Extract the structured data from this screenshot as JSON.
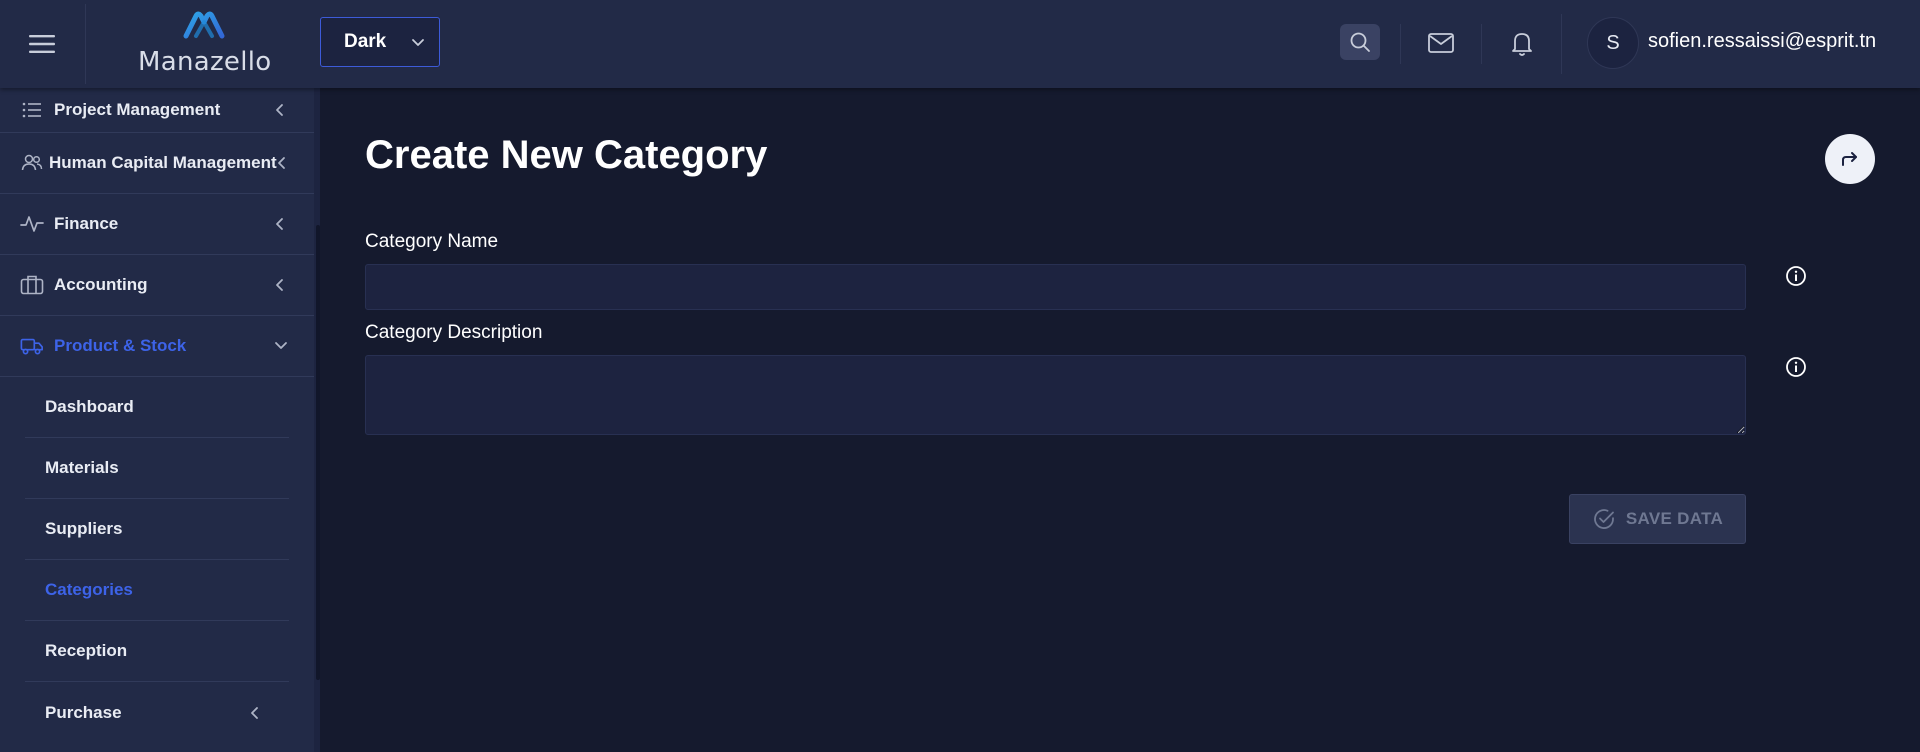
{
  "header": {
    "logo_text": "Manazello",
    "theme_select": {
      "value": "Dark"
    },
    "user_initial": "S",
    "user_email": "sofien.ressaissi@esprit.tn"
  },
  "sidebar": {
    "items": [
      {
        "label": "Project Management",
        "icon": "list-icon"
      },
      {
        "label": "Human Capital Management",
        "icon": "users-icon"
      },
      {
        "label": "Finance",
        "icon": "activity-icon"
      },
      {
        "label": "Accounting",
        "icon": "briefcase-icon"
      },
      {
        "label": "Product & Stock",
        "icon": "truck-icon",
        "expanded": true
      }
    ],
    "subitems": [
      {
        "label": "Dashboard"
      },
      {
        "label": "Materials"
      },
      {
        "label": "Suppliers"
      },
      {
        "label": "Categories",
        "active": true
      },
      {
        "label": "Reception"
      },
      {
        "label": "Purchase"
      }
    ]
  },
  "main": {
    "title": "Create New Category",
    "fields": [
      {
        "label": "Category Name",
        "value": "",
        "placeholder": ""
      },
      {
        "label": "Category Description",
        "value": "",
        "placeholder": ""
      }
    ],
    "save_label": "SAVE DATA"
  },
  "colors": {
    "accent": "#3d63e8",
    "topbar_bg": "#222a47",
    "sidebar_bg": "#222a47",
    "main_bg": "#151a2e"
  }
}
